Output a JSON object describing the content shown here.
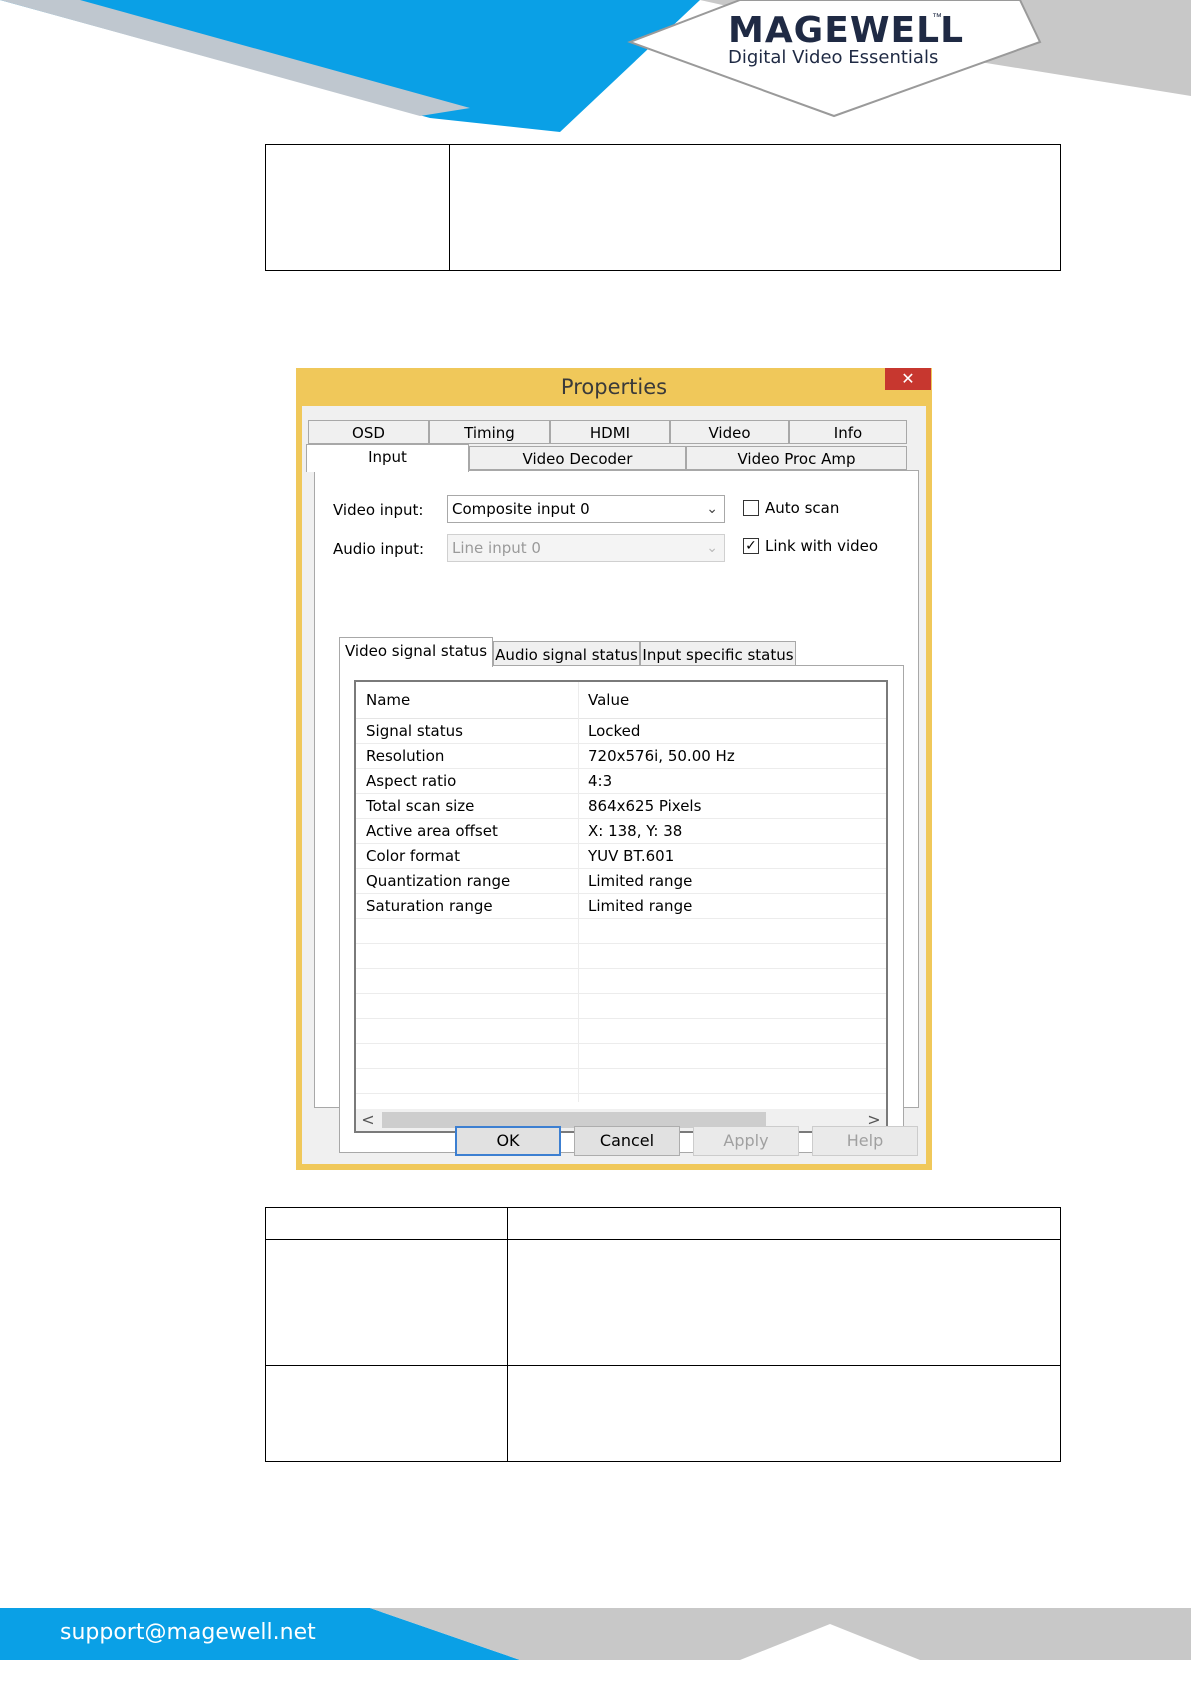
{
  "branding": {
    "name": "MAGEWELL",
    "trademark": "™",
    "tagline": "Digital Video Essentials",
    "colors": {
      "blue": "#0aa0e6",
      "gray": "#c8c8c8",
      "dark": "#1f2a44"
    }
  },
  "footer": {
    "email": "support@magewell.net"
  },
  "dialog": {
    "title": "Properties",
    "close_icon": "close-icon",
    "tabs_top": [
      "OSD",
      "Timing",
      "HDMI",
      "Video",
      "Info"
    ],
    "tabs_bottom": [
      "Input",
      "Video Decoder",
      "Video Proc Amp"
    ],
    "active_tab": "Input",
    "video_input": {
      "label": "Video input:",
      "value": "Composite input 0"
    },
    "audio_input": {
      "label": "Audio input:",
      "value": "Line input 0"
    },
    "auto_scan": {
      "label": "Auto scan",
      "checked": false
    },
    "link_with_video": {
      "label": "Link with video",
      "checked": true,
      "mark": "✓"
    },
    "status_tabs": [
      "Video signal status",
      "Audio signal status",
      "Input specific status"
    ],
    "active_status_tab": "Video signal status",
    "table": {
      "headers": [
        "Name",
        "Value"
      ],
      "rows": [
        {
          "name": "Signal status",
          "value": "Locked"
        },
        {
          "name": "Resolution",
          "value": "720x576i, 50.00 Hz"
        },
        {
          "name": "Aspect ratio",
          "value": "4:3"
        },
        {
          "name": "Total scan size",
          "value": "864x625 Pixels"
        },
        {
          "name": "Active area offset",
          "value": "X: 138, Y: 38"
        },
        {
          "name": "Color format",
          "value": "YUV BT.601"
        },
        {
          "name": "Quantization range",
          "value": "Limited range"
        },
        {
          "name": "Saturation range",
          "value": "Limited range"
        }
      ]
    },
    "scroll": {
      "left": "<",
      "right": ">"
    },
    "buttons": {
      "ok": "OK",
      "cancel": "Cancel",
      "apply": "Apply",
      "help": "Help"
    }
  }
}
